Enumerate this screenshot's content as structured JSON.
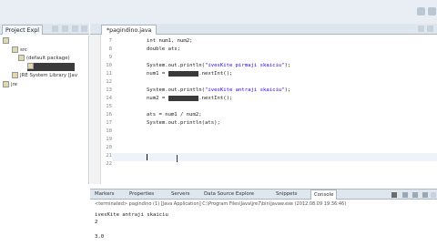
{
  "explorer": {
    "tab_label": "Project Expl",
    "items": [
      {
        "label": "src"
      },
      {
        "label": "(default package)"
      },
      {
        "label": "pagindino.java"
      },
      {
        "label": "JRE System Library [Jav"
      },
      {
        "label": "jre"
      }
    ]
  },
  "editor": {
    "tab_label": "*pagindino.java",
    "lines": [
      {
        "num": "7",
        "text": "int num1, num2;"
      },
      {
        "num": "8",
        "text": "double ats;"
      },
      {
        "num": "9",
        "text": ""
      },
      {
        "num": "10",
        "pre": "System.out.println(",
        "str": "\"ivesKite pirmaji skaiciu\"",
        "post": ");"
      },
      {
        "num": "11",
        "pre": "num1 = ",
        "hl": "klaviatura",
        "post": ".nextInt();"
      },
      {
        "num": "12",
        "text": ""
      },
      {
        "num": "13",
        "pre": "System.out.println(",
        "str": "\"ivesKite antraji skaiciu\"",
        "post": ");"
      },
      {
        "num": "14",
        "pre": "num2 = ",
        "hl": "klaviatura",
        "post": ".nextInt();"
      },
      {
        "num": "15",
        "text": ""
      },
      {
        "num": "16",
        "text": "ats = num1 / num2;"
      },
      {
        "num": "17",
        "text": "System.out.println(ats);"
      },
      {
        "num": "18",
        "text": ""
      },
      {
        "num": "19",
        "text": ""
      },
      {
        "num": "20",
        "text": ""
      },
      {
        "num": "21",
        "text": ""
      },
      {
        "num": "22",
        "text": ""
      }
    ]
  },
  "bottom_panel": {
    "tabs": [
      "Markers",
      "Properties",
      "Servers",
      "Data Source Explore",
      "Snippets",
      "Console"
    ],
    "status": "<terminated> pagindino (1) [Java Application] C:\\Program Files\\Java\\jre7\\bin\\javaw.exe (2012.08.09 19:36:46)",
    "output": [
      "ivesKite antraji skaiciu",
      "2",
      "3.0"
    ]
  },
  "colors": {
    "keyword": "#7f0055",
    "string": "#2a00ff",
    "highlight": "#3a3a3a"
  }
}
